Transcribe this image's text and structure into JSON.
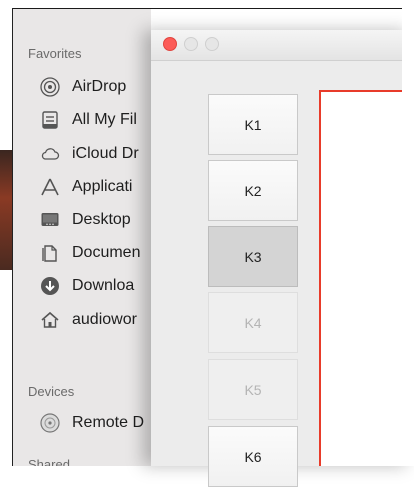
{
  "sidebar": {
    "favorites_label": "Favorites",
    "favorites": [
      {
        "label": "AirDrop",
        "icon": "airdrop-icon"
      },
      {
        "label": "All My Fil",
        "icon": "all-my-files-icon"
      },
      {
        "label": "iCloud Dr",
        "icon": "cloud-icon"
      },
      {
        "label": "Applicati",
        "icon": "applications-icon"
      },
      {
        "label": "Desktop",
        "icon": "desktop-icon"
      },
      {
        "label": "Documen",
        "icon": "documents-icon"
      },
      {
        "label": "Downloa",
        "icon": "downloads-icon"
      },
      {
        "label": "audiowor",
        "icon": "home-icon"
      }
    ],
    "devices_label": "Devices",
    "devices": [
      {
        "label": "Remote D",
        "icon": "remote-disc-icon"
      }
    ],
    "shared_label": "Shared"
  },
  "window": {
    "buttons": [
      {
        "label": "K1",
        "state": "normal"
      },
      {
        "label": "K2",
        "state": "normal"
      },
      {
        "label": "K3",
        "state": "pressed"
      },
      {
        "label": "K4",
        "state": "disabled"
      },
      {
        "label": "K5",
        "state": "disabled"
      },
      {
        "label": "K6",
        "state": "normal"
      }
    ]
  },
  "colors": {
    "close": "#fc5b57",
    "canvas_border": "#e83b2a",
    "sidebar_bg": "#e9e7e7"
  }
}
